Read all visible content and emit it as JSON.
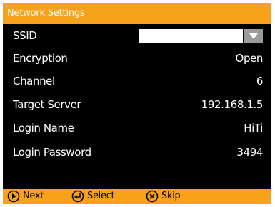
{
  "title": "Network Settings",
  "rows": [
    {
      "label": "SSID",
      "value": ""
    },
    {
      "label": "Encryption",
      "value": "Open"
    },
    {
      "label": "Channel",
      "value": "6"
    },
    {
      "label": "Target Server",
      "value": "192.168.1.5"
    },
    {
      "label": "Login Name",
      "value": "HiTi"
    },
    {
      "label": "Login Password",
      "value": "3494"
    }
  ],
  "footer": {
    "next_label": "Next",
    "select_label": "Select",
    "skip_label": "Skip"
  },
  "icons": {
    "next": "play-circle-icon",
    "select": "enter-circle-icon",
    "skip": "x-circle-icon",
    "dropdown": "triangle-down-icon"
  },
  "colors": {
    "title_bar": "#f6a21b",
    "footer_bar": "#f6a21b",
    "screen_bg": "#000000",
    "text": "#ffffff",
    "dropdown_button": "#9a9a9a"
  }
}
